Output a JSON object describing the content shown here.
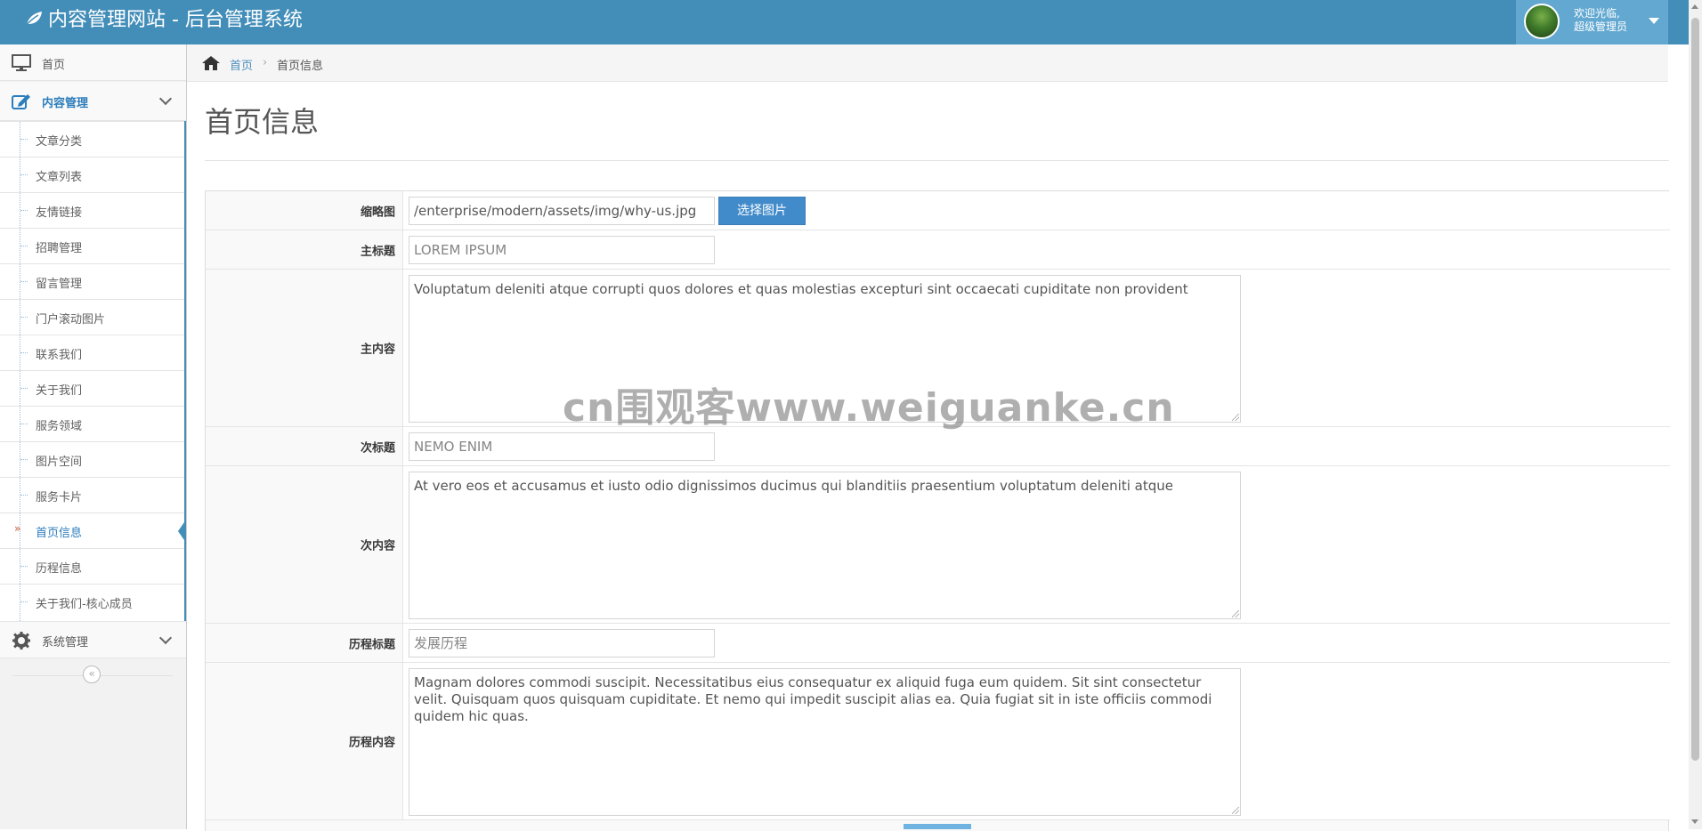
{
  "header": {
    "brand": "内容管理网站 - 后台管理系统",
    "welcome": "欢迎光临,",
    "role": "超级管理员"
  },
  "sidebar": {
    "home": "首页",
    "content_menu": "内容管理",
    "items": [
      {
        "label": "文章分类"
      },
      {
        "label": "文章列表"
      },
      {
        "label": "友情链接"
      },
      {
        "label": "招聘管理"
      },
      {
        "label": "留言管理"
      },
      {
        "label": "门户滚动图片"
      },
      {
        "label": "联系我们"
      },
      {
        "label": "关于我们"
      },
      {
        "label": "服务领域"
      },
      {
        "label": "图片空间"
      },
      {
        "label": "服务卡片"
      },
      {
        "label": "首页信息",
        "active": true
      },
      {
        "label": "历程信息"
      },
      {
        "label": "关于我们-核心成员"
      }
    ],
    "system_menu": "系统管理",
    "collapse_glyph": "«"
  },
  "breadcrumb": {
    "home": "首页",
    "separator": "›",
    "current": "首页信息"
  },
  "page": {
    "title": "首页信息"
  },
  "form": {
    "thumbnail": {
      "label": "缩略图",
      "value": "/enterprise/modern/assets/img/why-us.jpg",
      "button": "选择图片"
    },
    "main_title": {
      "label": "主标题",
      "value": "LOREM IPSUM"
    },
    "main_content": {
      "label": "主内容",
      "value": "Voluptatum deleniti atque corrupti quos dolores et quas molestias excepturi sint occaecati cupiditate non provident"
    },
    "sub_title": {
      "label": "次标题",
      "value": "NEMO ENIM"
    },
    "sub_content": {
      "label": "次内容",
      "value": "At vero eos et accusamus et iusto odio dignissimos ducimus qui blanditiis praesentium voluptatum deleniti atque"
    },
    "history_title": {
      "label": "历程标题",
      "value": "发展历程"
    },
    "history_content": {
      "label": "历程内容",
      "value": "Magnam dolores commodi suscipit. Necessitatibus eius consequatur ex aliquid fuga eum quidem. Sit sint consectetur velit. Quisquam quos quisquam cupiditate. Et nemo qui impedit suscipit alias ea. Quia fugiat sit in iste officiis commodi quidem hic quas."
    }
  },
  "watermark": "cn围观客www.weiguanke.cn",
  "colors": {
    "navbar": "#438eb9",
    "user_box": "#62a8d1",
    "link": "#2b7dbc",
    "button": "#428bca"
  }
}
